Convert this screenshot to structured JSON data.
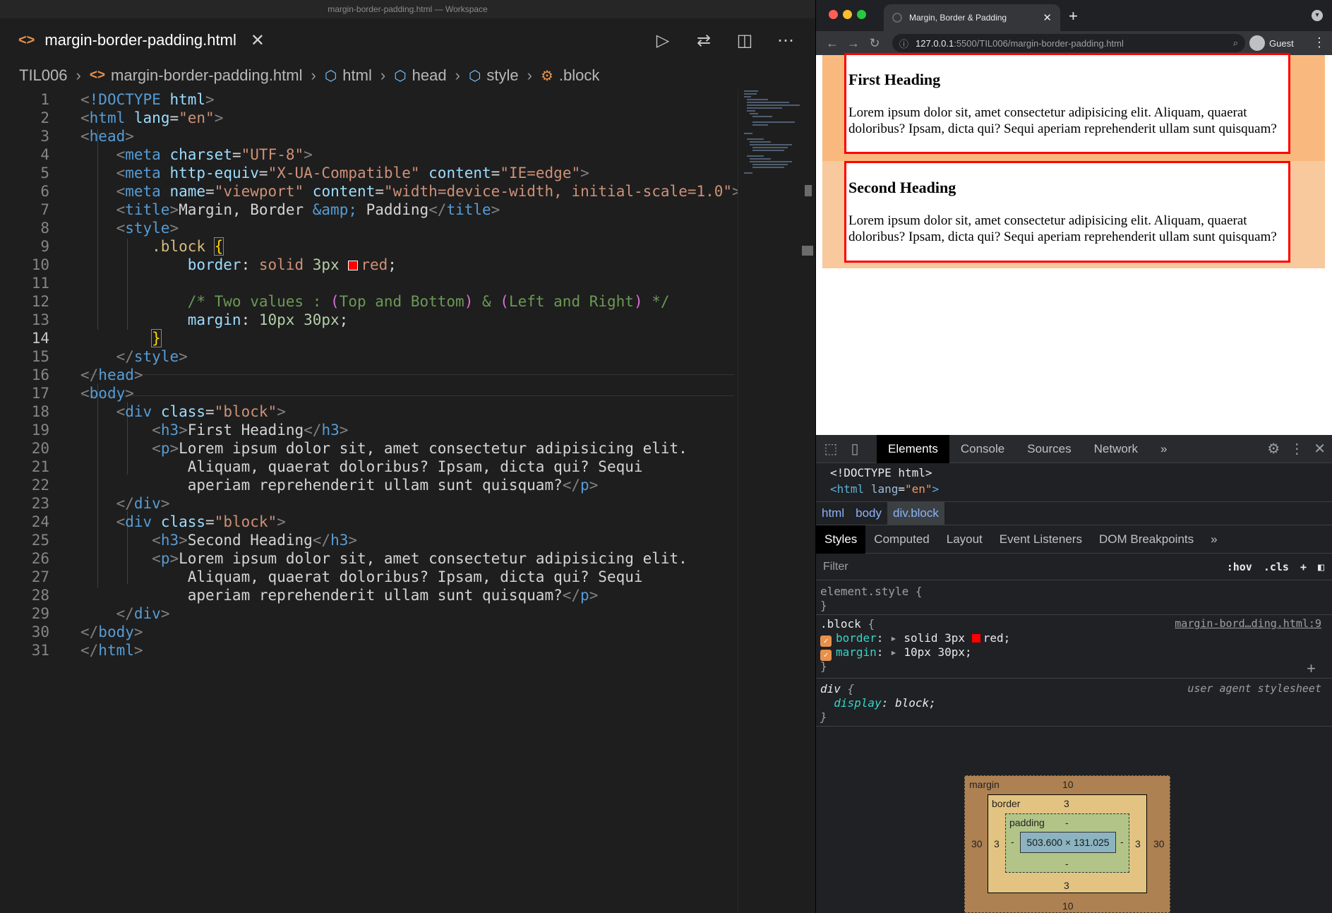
{
  "vscode": {
    "window_title": "margin-border-padding.html — Workspace",
    "tab": {
      "label": "margin-border-padding.html"
    },
    "breadcrumb": [
      "TIL006",
      "margin-border-padding.html",
      "html",
      "head",
      "style",
      ".block"
    ],
    "active_line": 14
  },
  "chrome": {
    "tab_title": "Margin, Border & Padding",
    "url_host": "127.0.0.1",
    "url_rest": ":5500/TIL006/margin-border-padding.html",
    "profile": "Guest"
  },
  "page": {
    "blocks": [
      {
        "heading": "First Heading",
        "text": "Lorem ipsum dolor sit, amet consectetur adipisicing elit. Aliquam, quaerat doloribus? Ipsam, dicta qui? Sequi aperiam reprehenderit ullam sunt quisquam?"
      },
      {
        "heading": "Second Heading",
        "text": "Lorem ipsum dolor sit, amet consectetur adipisicing elit. Aliquam, quaerat doloribus? Ipsam, dicta qui? Sequi aperiam reprehenderit ullam sunt quisquam?"
      }
    ]
  },
  "devtools": {
    "tabs": [
      "Elements",
      "Console",
      "Sources",
      "Network"
    ],
    "dom": {
      "doctype": "<!DOCTYPE html>",
      "html_tag": "html",
      "lang_attr": "lang",
      "lang_val": "\"en\""
    },
    "crumbs": [
      "html",
      "body",
      "div.block"
    ],
    "subtabs": [
      "Styles",
      "Computed",
      "Layout",
      "Event Listeners",
      "DOM Breakpoints"
    ],
    "filter_placeholder": "Filter",
    "hov": ":hov",
    "cls": ".cls",
    "element_style": "element.style {",
    "close_brace": "}",
    "rule1": {
      "selector": ".block",
      "source": "margin-bord…ding.html:9",
      "p1_name": "border",
      "p1_value": "solid 3px",
      "p1_color": "red;",
      "p2_name": "margin",
      "p2_value": "10px 30px;"
    },
    "rule2": {
      "selector": "div",
      "source": "user agent stylesheet",
      "p1_name": "display",
      "p1_value": "block;"
    },
    "boxmodel": {
      "margin_label": "margin",
      "border_label": "border",
      "padding_label": "padding",
      "content": "503.600 × 131.025",
      "margin_top": "10",
      "margin_bottom": "10",
      "margin_left": "30",
      "margin_right": "30",
      "border_top": "3",
      "border_bottom": "3",
      "border_left": "3",
      "border_right": "3",
      "padding_top": "-",
      "padding_bottom": "-",
      "padding_left": "-",
      "padding_right": "-"
    }
  },
  "code": {
    "l1": "<!DOCTYPE html>",
    "l2_tag": "html",
    "l2_attr": "lang",
    "l2_val": "\"en\"",
    "l3": "head",
    "l4_attr": "charset",
    "l4_val": "\"UTF-8\"",
    "l5_attr1": "http-equiv",
    "l5_val1": "\"X-UA-Compatible\"",
    "l5_attr2": "content",
    "l5_val2": "\"IE=edge\"",
    "l6_attr1": "name",
    "l6_val1": "\"viewport\"",
    "l6_attr2": "content",
    "l6_val2": "\"width=device-width, initial-scale=1.0\"",
    "l7_text1": "Margin, Border ",
    "l7_ent": "&amp;",
    "l7_text2": " Padding",
    "l9_sel": ".block",
    "l10_prop": "border",
    "l10_val": "solid",
    "l10_num": "3px",
    "l10_color": "red",
    "l12_com1": "/* Two values : ",
    "l12_p1": "(",
    "l12_c2": "Top and Bottom",
    "l12_p2": ")",
    "l12_c3": " & ",
    "l12_p3": "(",
    "l12_c4": "Left and Right",
    "l12_p4": ")",
    "l12_c5": " */",
    "l13_prop": "margin",
    "l13_num": "10px 30px",
    "l18_attr": "class",
    "l18_val": "\"block\"",
    "l19_text": "First Heading",
    "l20_text": "Lorem ipsum dolor sit, amet consectetur adipisicing elit.",
    "l21_text": "Aliquam, quaerat doloribus? Ipsam, dicta qui? Sequi",
    "l22_text": "aperiam reprehenderit ullam sunt quisquam?",
    "l25_text": "Second Heading"
  },
  "colors": {
    "accent_red": "#ff0000",
    "page_margin": "#f9b97e"
  }
}
